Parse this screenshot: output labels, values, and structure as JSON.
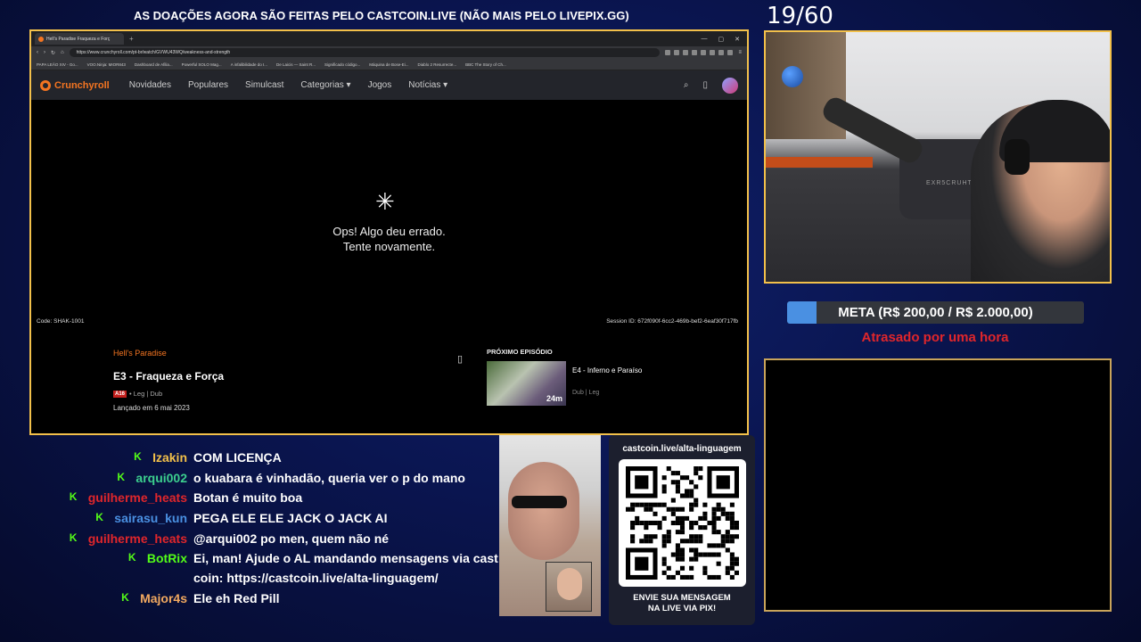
{
  "overlay": {
    "banner": "AS DOAÇÕES AGORA SÃO FEITAS PELO CASTCOIN.LIVE (NÃO MAIS PELO LIVEPIX.GG)",
    "counter": "19/60",
    "goal_text": "META (R$ 200,00 / R$ 2.000,00)",
    "goal_progress": 0.1,
    "delay_text": "Atrasado por uma hora",
    "qr_url": "castcoin.live/alta-linguagem",
    "qr_cta_line1": "ENVIE SUA MENSAGEM",
    "qr_cta_line2": "NA LIVE VIA PIX!",
    "webcam_chair_text": "EXR5CRUHT"
  },
  "browser": {
    "tab_title": "Hell's Paradise Fraqueza e Forç",
    "new_tab": "+",
    "url": "https://www.crunchyroll.com/pt-br/watch/GVWU43WQ/weakness-and-strength",
    "bookmarks": [
      "PAPA LEÃO XIV - Go...",
      "VOO.Ninja: MIOR843",
      "Dashboard de Afilia...",
      "Powerful SOLO Mag...",
      "A infalibilidade do I...",
      "De Laicis — Saint R...",
      "Significado código...",
      "Máquina de Bose-Ei...",
      "Diablo 2 Resurrecte...",
      "BBC The Story of Ch..."
    ],
    "window_controls": [
      "—",
      "▢",
      "✕"
    ]
  },
  "crunchyroll": {
    "logo": "Crunchyroll",
    "nav": [
      "Novidades",
      "Populares",
      "Simulcast",
      "Categorias ▾",
      "Jogos",
      "Notícias ▾"
    ],
    "error_icon": "✳",
    "error_line1": "Ops! Algo deu errado.",
    "error_line2": "Tente novamente.",
    "code": "Code: SHAK-1001",
    "session": "Session ID: 672f090f-6cc2-469b-bef2-6eaf30f717fb",
    "series": "Hell's Paradise",
    "episode_title": "E3 - Fraqueza e Força",
    "rating": "A16",
    "audio": "• Leg | Dub",
    "release": "Lançado em 6 mai 2023",
    "next_header": "PRÓXIMO EPISÓDIO",
    "next_title": "E4 - Inferno e Paraíso",
    "next_sub": "Dub | Leg",
    "next_duration": "24m"
  },
  "chat": [
    {
      "user": "Izakin",
      "color": "#f2c04a",
      "msg": "COM LICENÇA",
      "msg2": ""
    },
    {
      "user": "arqui002",
      "color": "#3ccf8e",
      "msg": "o kuabara é vinhadão, queria ver o p do mano",
      "msg2": ""
    },
    {
      "user": "guilherme_heats",
      "color": "#e0262b",
      "msg": "Botan é muito boa",
      "msg2": ""
    },
    {
      "user": "sairasu_kun",
      "color": "#4a90e2",
      "msg": "PEGA ELE ELE JACK O JACK AI",
      "msg2": ""
    },
    {
      "user": "guilherme_heats",
      "color": "#e0262b",
      "msg": "@arqui002 po men, quem não né",
      "msg2": ""
    },
    {
      "user": "BotRix",
      "color": "#53fc18",
      "msg": "Ei, man! Ajude o AL mandando mensagens via cast",
      "msg2": "coin: https://castcoin.live/alta-linguagem/"
    },
    {
      "user": "Major4s",
      "color": "#f2a960",
      "msg": "Ele eh Red Pill",
      "msg2": ""
    }
  ],
  "chat_badge": "K"
}
